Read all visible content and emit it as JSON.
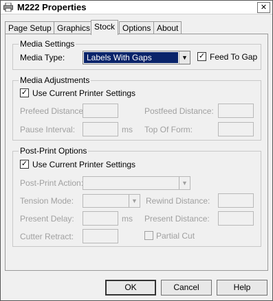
{
  "window": {
    "title": "M222 Properties",
    "close_glyph": "✕",
    "icon": "printer-icon"
  },
  "tabs": [
    {
      "label": "Page Setup"
    },
    {
      "label": "Graphics"
    },
    {
      "label": "Stock"
    },
    {
      "label": "Options"
    },
    {
      "label": "About"
    }
  ],
  "active_tab": "Stock",
  "media_settings": {
    "title": "Media Settings",
    "media_type_label": "Media Type:",
    "media_type_value": "Labels With Gaps",
    "feed_to_gap_label": "Feed To Gap",
    "feed_to_gap_checked": true
  },
  "media_adjustments": {
    "title": "Media Adjustments",
    "use_current_label": "Use Current Printer Settings",
    "use_current_checked": true,
    "prefeed_label": "Prefeed Distance:",
    "postfeed_label": "Postfeed Distance:",
    "pause_label": "Pause Interval:",
    "pause_unit": "ms",
    "top_of_form_label": "Top Of Form:"
  },
  "post_print": {
    "title": "Post-Print Options",
    "use_current_label": "Use Current Printer Settings",
    "use_current_checked": true,
    "action_label": "Post-Print Action:",
    "tension_label": "Tension Mode:",
    "rewind_label": "Rewind Distance:",
    "present_delay_label": "Present Delay:",
    "present_delay_unit": "ms",
    "present_distance_label": "Present Distance:",
    "cutter_label": "Cutter Retract:",
    "partial_cut_label": "Partial Cut",
    "partial_cut_checked": false
  },
  "buttons": {
    "ok": "OK",
    "cancel": "Cancel",
    "help": "Help"
  },
  "check_glyph": "✓",
  "arrow_glyph": "▼"
}
